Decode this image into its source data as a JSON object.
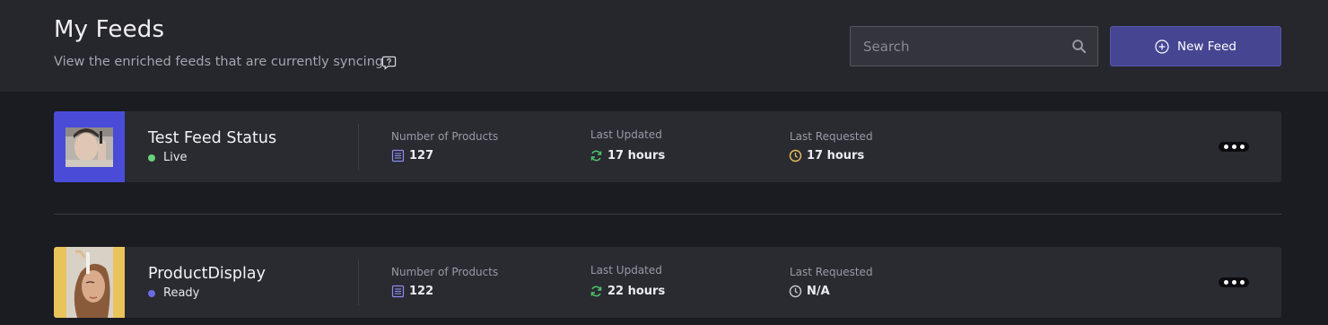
{
  "header": {
    "title": "My Feeds",
    "subtitle": "View the enriched feeds that are currently syncing"
  },
  "search": {
    "placeholder": "Search",
    "value": ""
  },
  "new_feed_button": {
    "label": "New Feed"
  },
  "feeds": [
    {
      "name": "Test Feed Status",
      "status": "Live",
      "status_color": "#6bd07a",
      "products_label": "Number of Products",
      "products_value": "127",
      "updated_label": "Last Updated",
      "updated_value": "17 hours",
      "requested_label": "Last Requested",
      "requested_value": "17 hours",
      "requested_icon_color": "#e8c35a"
    },
    {
      "name": "ProductDisplay",
      "status": "Ready",
      "status_color": "#6b6be6",
      "products_label": "Number of Products",
      "products_value": "122",
      "updated_label": "Last Updated",
      "updated_value": "22 hours",
      "requested_label": "Last Requested",
      "requested_value": "N/A",
      "requested_icon_color": "#c8c8d0"
    }
  ],
  "icons": {
    "help": "chat-question-icon",
    "search": "search-icon",
    "new_feed": "plus-circle-icon",
    "products": "list-icon",
    "updated": "sync-icon",
    "requested": "clock-icon",
    "more": "more-dots-icon"
  },
  "colors": {
    "accent": "#454592",
    "product_icon": "#8c8cf0",
    "sync_icon": "#4cc46a"
  }
}
